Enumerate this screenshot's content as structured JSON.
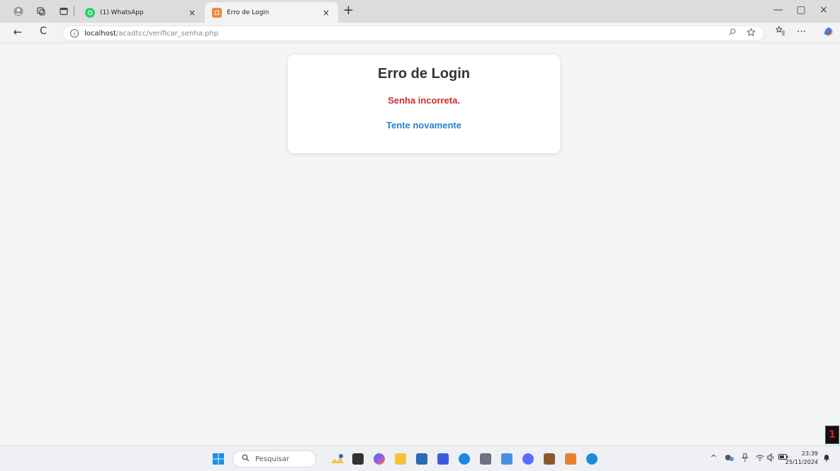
{
  "browser": {
    "tabs": [
      {
        "title": "(1) WhatsApp",
        "close": "×",
        "favicon_color": "#25d366"
      },
      {
        "title": "Erro de Login",
        "close": "×",
        "favicon_color": "#f0883e"
      }
    ],
    "new_tab": "+",
    "window_controls": {
      "minimize": "—",
      "restore": "▢",
      "close": "×"
    },
    "nav": {
      "back": "←",
      "reload": "C"
    },
    "address": {
      "host": "localhost",
      "path": "/acadtcc/verificar_senha.php"
    },
    "toolbar_icons": [
      "search-icon",
      "favorite-star-icon",
      "favorites-icon",
      "more-icon",
      "copilot-icon"
    ],
    "more_label": "···"
  },
  "page": {
    "heading": "Erro de Login",
    "error_message": "Senha incorreta.",
    "retry_link": "Tente novamente"
  },
  "taskbar": {
    "search_placeholder": "Pesquisar",
    "clock_time": "23:39",
    "clock_date": "25/11/2024",
    "notification_count": "1",
    "tray_icons": [
      "chevron-up-icon",
      "cloud-icon",
      "mic-icon",
      "wifi-icon",
      "volume-icon",
      "battery-icon",
      "notification-icon"
    ],
    "app_colors": [
      "#f3c24b",
      "#333333",
      "#7b5cff",
      "#f5c33b",
      "#2b6cb0",
      "#3b5bdb",
      "#1e88e5",
      "#6b7280",
      "#4a90e2",
      "#5b6cff",
      "#8b5a2b",
      "#e8822e",
      "#1a8fd8"
    ]
  },
  "colors": {
    "error": "#d42a2a",
    "link": "#2a7fd4"
  }
}
